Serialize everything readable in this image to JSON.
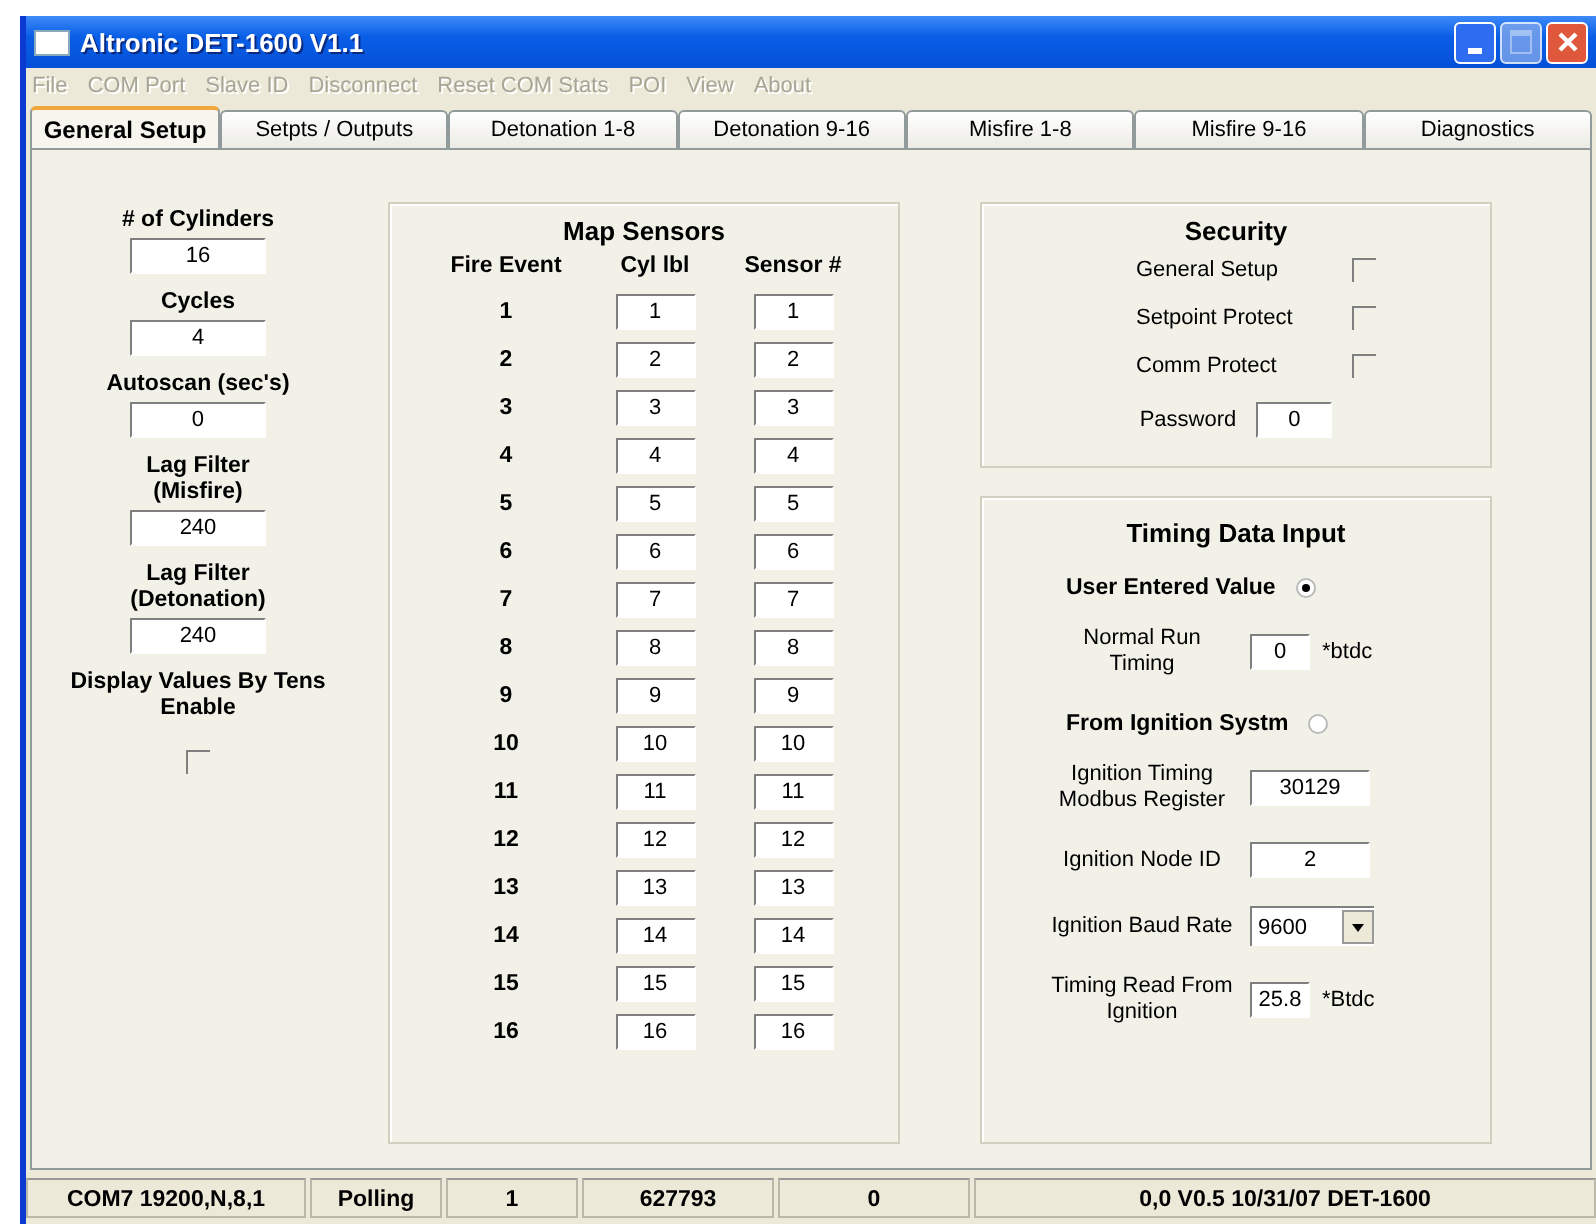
{
  "window": {
    "title": "Altronic DET-1600 V1.1"
  },
  "menu": [
    {
      "label": "File",
      "disabled": true
    },
    {
      "label": "COM Port",
      "disabled": true
    },
    {
      "label": "Slave ID",
      "disabled": true
    },
    {
      "label": "Disconnect",
      "disabled": true
    },
    {
      "label": "Reset COM Stats",
      "disabled": true
    },
    {
      "label": "POI",
      "disabled": true
    },
    {
      "label": "View",
      "disabled": true
    },
    {
      "label": "About",
      "disabled": true
    }
  ],
  "tabs": [
    {
      "label": "General Setup",
      "selected": true
    },
    {
      "label": "Setpts / Outputs",
      "selected": false
    },
    {
      "label": "Detonation 1-8",
      "selected": false
    },
    {
      "label": "Detonation 9-16",
      "selected": false
    },
    {
      "label": "Misfire 1-8",
      "selected": false
    },
    {
      "label": "Misfire 9-16",
      "selected": false
    },
    {
      "label": "Diagnostics",
      "selected": false
    }
  ],
  "general": [
    {
      "kind": "field",
      "label": "# of Cylinders",
      "value": "16"
    },
    {
      "kind": "field",
      "label": "Cycles",
      "value": "4"
    },
    {
      "kind": "field",
      "label": "Autoscan (sec's)",
      "value": "0"
    },
    {
      "kind": "field",
      "label": "Lag Filter\n(Misfire)",
      "value": "240"
    },
    {
      "kind": "field",
      "label": "Lag Filter\n(Detonation)",
      "value": "240"
    },
    {
      "kind": "checkbox",
      "label": "Display Values By Tens\nEnable",
      "checked": false
    }
  ],
  "map_sensors": {
    "title": "Map Sensors",
    "columns": [
      "Fire Event",
      "Cyl lbl",
      "Sensor #"
    ],
    "rows": [
      {
        "fire_event": "1",
        "cyl_lbl": "1",
        "sensor": "1"
      },
      {
        "fire_event": "2",
        "cyl_lbl": "2",
        "sensor": "2"
      },
      {
        "fire_event": "3",
        "cyl_lbl": "3",
        "sensor": "3"
      },
      {
        "fire_event": "4",
        "cyl_lbl": "4",
        "sensor": "4"
      },
      {
        "fire_event": "5",
        "cyl_lbl": "5",
        "sensor": "5"
      },
      {
        "fire_event": "6",
        "cyl_lbl": "6",
        "sensor": "6"
      },
      {
        "fire_event": "7",
        "cyl_lbl": "7",
        "sensor": "7"
      },
      {
        "fire_event": "8",
        "cyl_lbl": "8",
        "sensor": "8"
      },
      {
        "fire_event": "9",
        "cyl_lbl": "9",
        "sensor": "9"
      },
      {
        "fire_event": "10",
        "cyl_lbl": "10",
        "sensor": "10"
      },
      {
        "fire_event": "11",
        "cyl_lbl": "11",
        "sensor": "11"
      },
      {
        "fire_event": "12",
        "cyl_lbl": "12",
        "sensor": "12"
      },
      {
        "fire_event": "13",
        "cyl_lbl": "13",
        "sensor": "13"
      },
      {
        "fire_event": "14",
        "cyl_lbl": "14",
        "sensor": "14"
      },
      {
        "fire_event": "15",
        "cyl_lbl": "15",
        "sensor": "15"
      },
      {
        "fire_event": "16",
        "cyl_lbl": "16",
        "sensor": "16"
      }
    ]
  },
  "security": {
    "title": "Security",
    "options": [
      {
        "label": "General Setup",
        "checked": false
      },
      {
        "label": "Setpoint Protect",
        "checked": false
      },
      {
        "label": "Comm Protect",
        "checked": false
      }
    ],
    "password": {
      "label": "Password",
      "value": "0"
    }
  },
  "timing": {
    "title": "Timing Data Input",
    "items": [
      {
        "kind": "radio",
        "label": "User Entered Value",
        "selected": true
      },
      {
        "kind": "field",
        "label": "Normal Run\nTiming",
        "value": "0",
        "unit": "*btdc"
      },
      {
        "kind": "radio",
        "label": "From Ignition Systm",
        "selected": false
      },
      {
        "kind": "field",
        "label": "Ignition Timing\nModbus Register",
        "value": "30129"
      },
      {
        "kind": "field",
        "label": "Ignition Node ID",
        "value": "2"
      },
      {
        "kind": "dropdown",
        "label": "Ignition Baud Rate",
        "value": "9600"
      },
      {
        "kind": "readout",
        "label": "Timing Read From\nIgnition",
        "value": "25.8",
        "unit": "*Btdc"
      }
    ]
  },
  "status_bar": [
    "COM7 19200,N,8,1",
    "Polling",
    "1",
    "627793",
    "0",
    "0,0 V0.5 10/31/07 DET-1600"
  ]
}
